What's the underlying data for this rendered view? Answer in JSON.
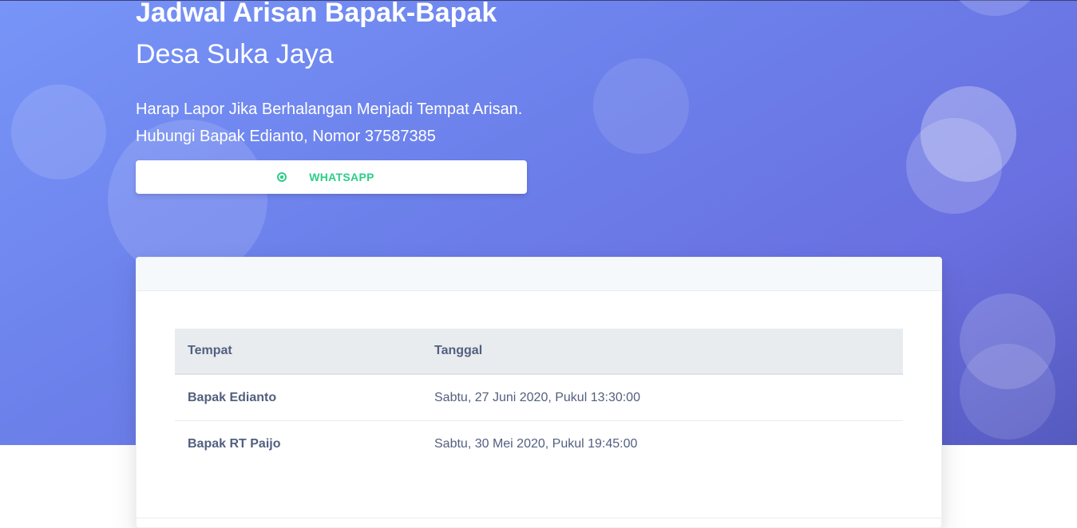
{
  "hero": {
    "title": "Jadwal Arisan Bapak-Bapak",
    "subtitle": "Desa Suka Jaya",
    "description_line1": "Harap Lapor Jika Berhalangan Menjadi Tempat Arisan.",
    "description_line2": "Hubungi Bapak Edianto, Nomor 37587385",
    "button": {
      "label": "WHATSAPP",
      "icon": "whatsapp-icon",
      "color": "#2dce89"
    },
    "gradient_colors": [
      "#7795f8",
      "#6a6fe0",
      "#555abf"
    ]
  },
  "table": {
    "headers": [
      "Tempat",
      "Tanggal"
    ],
    "rows": [
      {
        "tempat": "Bapak Edianto",
        "tanggal": "Sabtu, 27 Juni 2020, Pukul 13:30:00"
      },
      {
        "tempat": "Bapak RT Paijo",
        "tanggal": "Sabtu, 30 Mei 2020, Pukul 19:45:00"
      }
    ]
  }
}
